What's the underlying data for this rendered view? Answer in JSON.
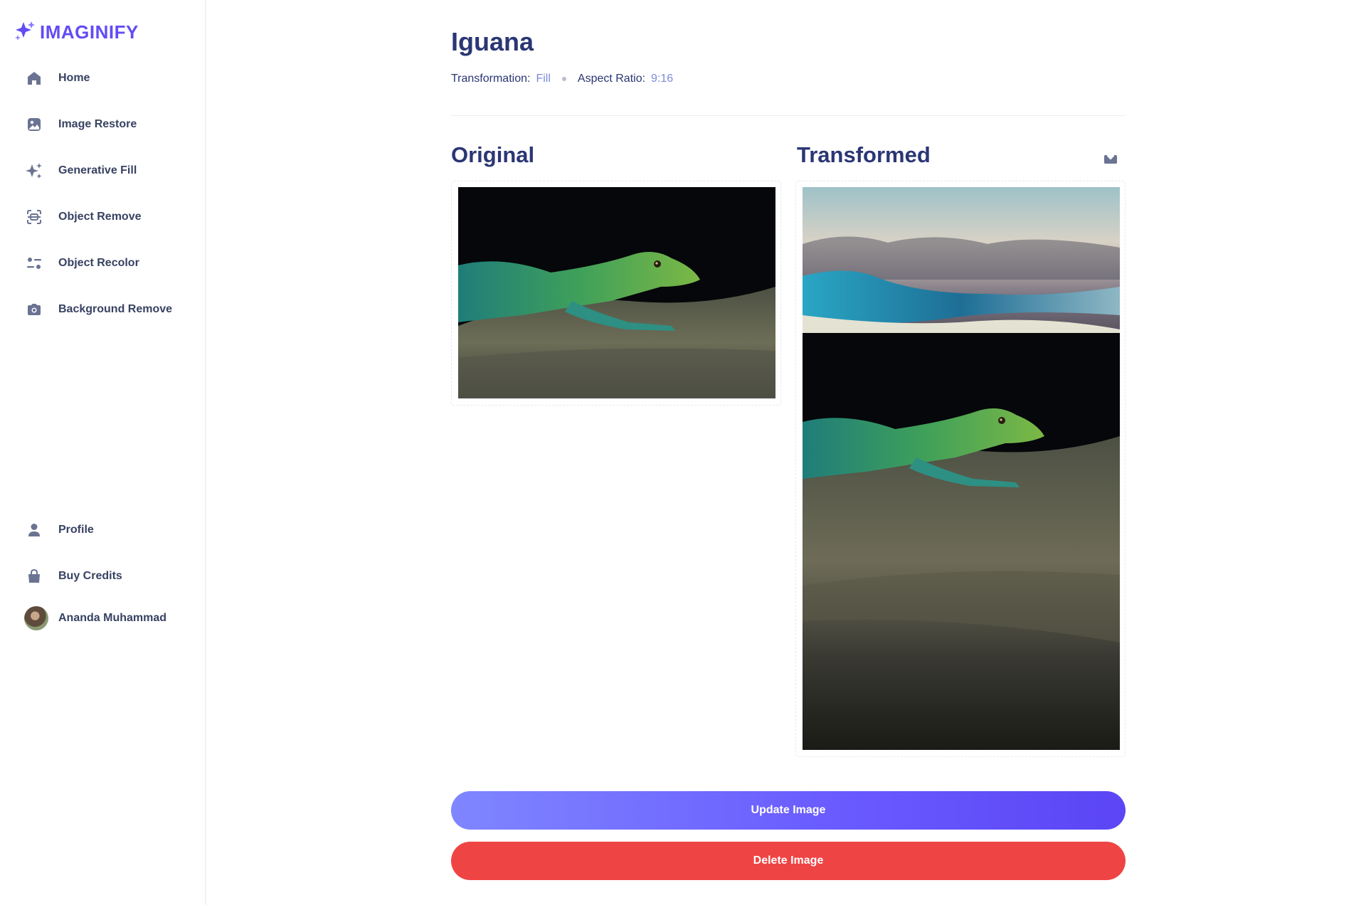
{
  "app": {
    "name": "IMAGINIFY",
    "brand_color": "#624cf5"
  },
  "sidebar": {
    "items": [
      {
        "label": "Home",
        "icon": "home-icon"
      },
      {
        "label": "Image Restore",
        "icon": "image-icon"
      },
      {
        "label": "Generative Fill",
        "icon": "stars-icon"
      },
      {
        "label": "Object Remove",
        "icon": "scan-icon"
      },
      {
        "label": "Object Recolor",
        "icon": "filter-icon"
      },
      {
        "label": "Background Remove",
        "icon": "camera-icon"
      }
    ],
    "bottom_items": [
      {
        "label": "Profile",
        "icon": "profile-icon"
      },
      {
        "label": "Buy Credits",
        "icon": "bag-icon"
      }
    ],
    "user": {
      "name": "Ananda Muhammad"
    }
  },
  "main": {
    "title": "Iguana",
    "transformation_label": "Transformation:",
    "transformation_value": "Fill",
    "aspect_label": "Aspect Ratio:",
    "aspect_value": "9:16",
    "original_heading": "Original",
    "transformed_heading": "Transformed",
    "download_icon": "download-icon"
  },
  "actions": {
    "update_label": "Update Image",
    "delete_label": "Delete Image",
    "update_color": "#6a5cff",
    "delete_color": "#ef4444"
  }
}
